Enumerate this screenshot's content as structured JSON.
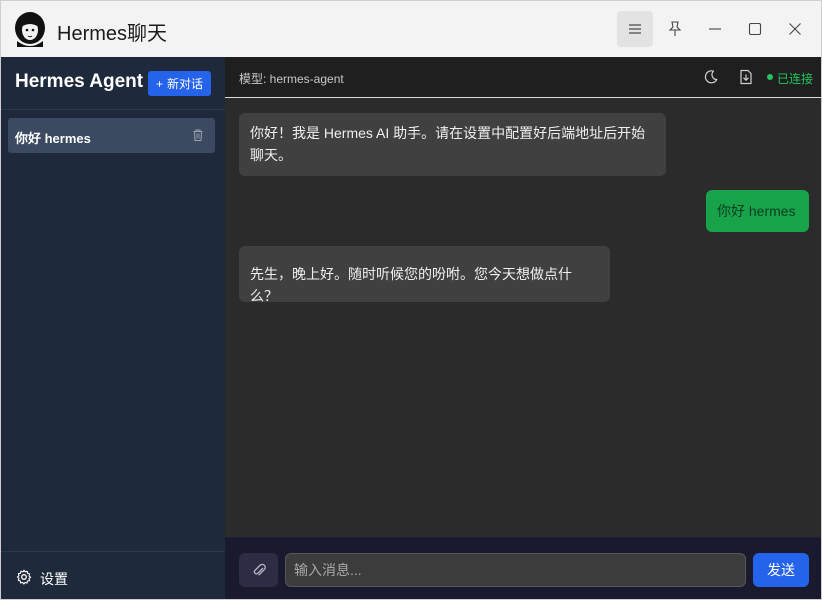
{
  "window": {
    "title": "Hermes聊天"
  },
  "sidebar": {
    "brand": "Hermes Agent",
    "new_chat_label": "新对话",
    "conversations": [
      {
        "label": "你好 hermes"
      }
    ],
    "settings_label": "设置"
  },
  "header": {
    "model": "模型: hermes-agent",
    "status": "已连接",
    "status_color": "#22c55e"
  },
  "messages": [
    {
      "role": "assistant",
      "text": "你好！我是 Hermes AI 助手。请在设置中配置好后端地址后开始聊天。"
    },
    {
      "role": "user",
      "text": "你好 hermes"
    },
    {
      "role": "assistant",
      "text": "先生，晚上好。随时听候您的吩咐。您今天想做点什么？"
    }
  ],
  "composer": {
    "placeholder": "输入消息...",
    "value": "",
    "send_label": "发送"
  },
  "colors": {
    "accent": "#2563eb",
    "user_bubble": "#16a34a",
    "sidebar_bg": "#1e293b",
    "chat_bg": "#2b2b2b"
  },
  "icons": [
    "app-logo-icon",
    "menu-icon",
    "pin-icon",
    "minimize-icon",
    "maximize-icon",
    "close-icon",
    "plus-icon",
    "trash-icon",
    "gear-icon",
    "moon-icon",
    "export-icon",
    "paperclip-icon"
  ]
}
